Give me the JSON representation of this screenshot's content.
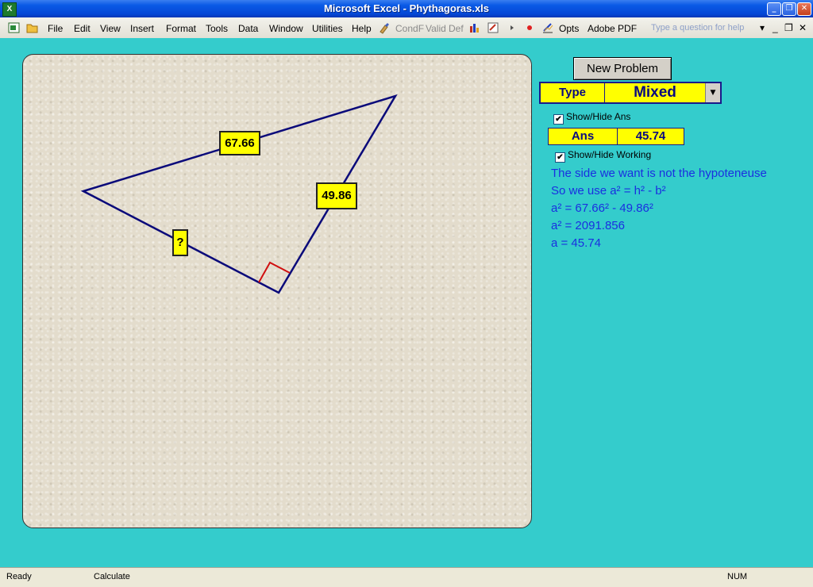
{
  "window": {
    "title": "Microsoft Excel - Phythagoras.xls",
    "minimize_glyph": "_",
    "restore_glyph": "❐",
    "close_glyph": "✕"
  },
  "menu": {
    "items": [
      "File",
      "Edit",
      "View",
      "Insert",
      "Format",
      "Tools",
      "Data",
      "Window",
      "Utilities",
      "Help"
    ],
    "toolbar_items": [
      "CondF",
      "Valid",
      "Def",
      "Opts",
      "Adobe PDF"
    ],
    "help_placeholder": "Type a question for help",
    "doc_controls": [
      "▾",
      "_",
      "❐",
      "✕"
    ]
  },
  "triangle": {
    "hypotenuse_label": "67.66",
    "side_b_label": "49.86",
    "unknown_label": "?",
    "colors": {
      "line": "#0a0a7a",
      "right_angle": "#d01010",
      "label_bg": "#ffff00"
    }
  },
  "controls": {
    "new_problem_label": "New Problem",
    "type_label": "Type",
    "type_value": "Mixed",
    "dropdown_glyph": "▼",
    "show_hide_ans_label": "Show/Hide Ans",
    "show_hide_ans_checked": true,
    "check_glyph": "✔",
    "ans_label": "Ans",
    "ans_value": "45.74",
    "show_hide_working_label": "Show/Hide Working",
    "show_hide_working_checked": true
  },
  "working": [
    "The side we want is not the hypoteneuse",
    "So we use a² = h² - b²",
    "a² = 67.66² - 49.86²",
    "a² = 2091.856",
    "a = 45.74"
  ],
  "status": {
    "ready": "Ready",
    "calculate": "Calculate",
    "num": "NUM"
  },
  "icons": [
    "excel-icon",
    "open-folder-icon",
    "brush-icon",
    "chart-icon",
    "macro-icon",
    "play-icon",
    "record-icon",
    "pencil-chart-icon"
  ]
}
